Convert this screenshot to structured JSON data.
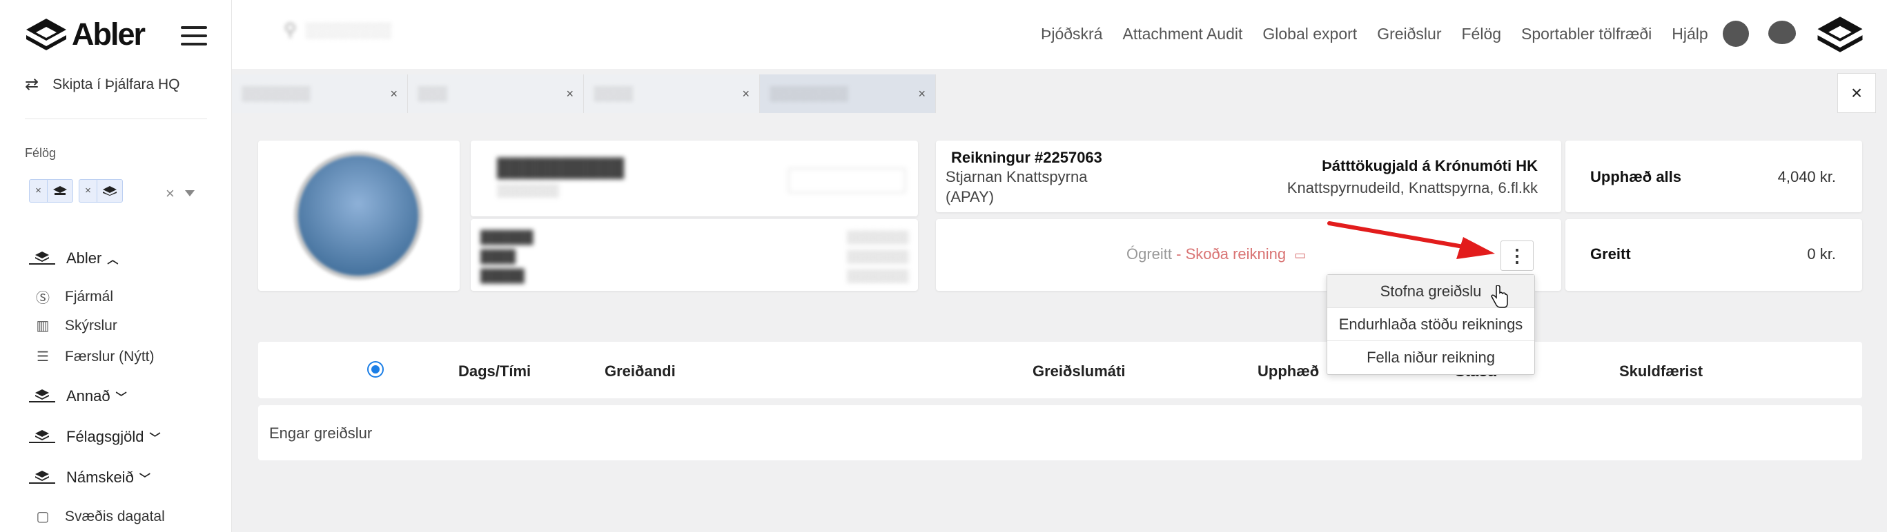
{
  "brand": {
    "name": "Abler"
  },
  "sidebar": {
    "switch_label": "Skipta í Þjálfara HQ",
    "clubs_label": "Félög",
    "sections": [
      {
        "label": "Abler"
      },
      {
        "label": "Annað"
      },
      {
        "label": "Félagsgjöld"
      },
      {
        "label": "Námskeið"
      }
    ],
    "items": [
      {
        "label": "Fjármál",
        "icon": "dollar-circle-icon"
      },
      {
        "label": "Skýrslur",
        "icon": "bar-chart-icon"
      },
      {
        "label": "Færslur (Nýtt)",
        "icon": "list-icon"
      },
      {
        "label": "Svæðis dagatal",
        "icon": "calendar-icon"
      }
    ]
  },
  "topbar": {
    "nav": [
      "Þjóðskrá",
      "Attachment Audit",
      "Global export",
      "Greiðslur",
      "Félög",
      "Sportabler tölfræði",
      "Hjálp"
    ]
  },
  "invoice": {
    "number": "Reikningur #2257063",
    "payer_line1": "Stjarnan Knattspyrna",
    "payer_line2": "(APAY)",
    "product": "Þátttökugjald á Krónumóti HK",
    "department": "Knattspyrnudeild, Knattspyrna, 6.fl.kk",
    "status": "Ógreitt",
    "view_link": " - Skoða reikning"
  },
  "summary": {
    "total_label": "Upphæð alls",
    "total_value": "4,040 kr.",
    "paid_label": "Greitt",
    "paid_value": "0 kr."
  },
  "menu": {
    "items": [
      "Stofna greiðslu",
      "Endurhlaða stöðu reiknings",
      "Fella niður reikning"
    ]
  },
  "payments_table": {
    "headers": [
      "Dags/Tími",
      "Greiðandi",
      "Greiðslumáti",
      "Upphæð",
      "Staða",
      "Skuldfærist"
    ],
    "empty": "Engar greiðslur"
  },
  "colors": {
    "accent": "#1b7ee6",
    "arrow": "#e21c1c",
    "link": "#d97373"
  }
}
